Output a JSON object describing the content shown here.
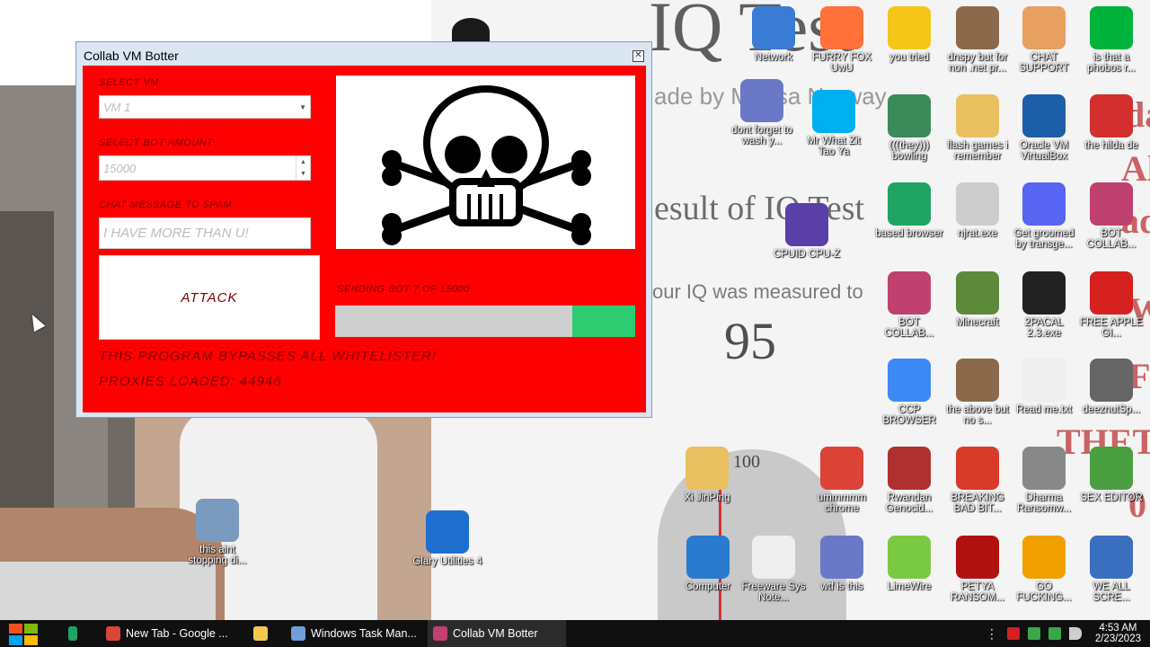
{
  "window": {
    "title": "Collab VM Botter",
    "close_glyph": "✕",
    "select_vm_label": "SELECT VM",
    "select_vm_value": "VM 1",
    "bot_amount_label": "SELECT BOT AMOUNT",
    "bot_amount_value": "15000",
    "chat_label": "CHAT MESSAGE TO SPAM",
    "chat_placeholder": "I HAVE MORE THAN U!",
    "attack_button": "ATTACK",
    "progress_label": "SENDING BOT 7 OF 15000",
    "progress_fraction": 0.21,
    "bypass_text": "THIS PROGRAM BYPASSES ALL WHITELISTER!",
    "proxies_text": "PROXIES LOADED: 44946",
    "colors": {
      "client": "#ff0000",
      "progress_fill": "#2ecc71"
    }
  },
  "wallpaper": {
    "iq_title": "IQ Test",
    "iq_by": "ade by Mensa Norway",
    "iq_result": "esult of IQ Test",
    "iq_measured": "our IQ was measured to",
    "iq_score": "95",
    "bell_label": "100",
    "side_texts": [
      "da",
      "Alt",
      "ade",
      "W",
      "F",
      "THETA",
      "0"
    ]
  },
  "desktop_icons": [
    {
      "label": "Network",
      "icon": "network-icon",
      "color": "#3a7bd5"
    },
    {
      "label": "FURRY FOX UwU",
      "icon": "firefox-icon",
      "color": "#ff7139"
    },
    {
      "label": "you tried",
      "icon": "star-icon",
      "color": "#f5c518"
    },
    {
      "label": "dnspy but for non .net pr...",
      "icon": "portrait-icon",
      "color": "#8a6a4a"
    },
    {
      "label": "CHAT SUPPORT",
      "icon": "support-icon",
      "color": "#e8a060"
    },
    {
      "label": "is that a phobos r...",
      "icon": "icq-icon",
      "color": "#00b33c"
    },
    {
      "label": "dont forget to wash y...",
      "icon": "calendar-icon",
      "color": "#6b78c8"
    },
    {
      "label": "Mr What Zit Tao Ya",
      "icon": "skype-icon",
      "color": "#00aff0"
    },
    {
      "label": "(((they))) bowling",
      "icon": "elf-icon",
      "color": "#3a8a5a"
    },
    {
      "label": "flash games i remember",
      "icon": "folder-icon",
      "color": "#e8c060"
    },
    {
      "label": "Oracle VM VirtualBox",
      "icon": "virtualbox-icon",
      "color": "#1c5fa8"
    },
    {
      "label": "the hilda de",
      "icon": "devcpp-icon",
      "color": "#d32f2f"
    },
    {
      "label": "CPUID CPU-Z",
      "icon": "cpuz-icon",
      "color": "#5b3fa8"
    },
    {
      "label": "based browser",
      "icon": "browser-icon",
      "color": "#1fa463"
    },
    {
      "label": "njrat.exe",
      "icon": "skull-icon",
      "color": "#cccccc"
    },
    {
      "label": "Get groomed by transge...",
      "icon": "discord-icon",
      "color": "#5865f2"
    },
    {
      "label": "BOT COLLAB...",
      "icon": "monitor-icon",
      "color": "#c04070"
    },
    {
      "label": "BOT COLLAB...",
      "icon": "monitor-icon",
      "color": "#c04070"
    },
    {
      "label": "Minecraft",
      "icon": "minecraft-icon",
      "color": "#5d8a3a"
    },
    {
      "label": "2PACAL 2.3.exe",
      "icon": "console-icon",
      "color": "#222222"
    },
    {
      "label": "FREE APPLE GI...",
      "icon": "apple-icon",
      "color": "#d61f1f"
    },
    {
      "label": "CCP BROWSER",
      "icon": "chromium-icon",
      "color": "#3d8af7"
    },
    {
      "label": "the above but no s...",
      "icon": "portrait-icon",
      "color": "#8a6a4a"
    },
    {
      "label": "Read me.txt",
      "icon": "document-icon",
      "color": "#eeeeee"
    },
    {
      "label": "deeznutSp...",
      "icon": "windows-stack-icon",
      "color": "#666666"
    },
    {
      "label": "Xi JinPing",
      "icon": "folder-icon",
      "color": "#e8c060"
    },
    {
      "label": "ummmmm chrome",
      "icon": "chrome-icon",
      "color": "#db4437"
    },
    {
      "label": "Rwandan Genocid...",
      "icon": "meme-icon",
      "color": "#b03030"
    },
    {
      "label": "BREAKING BAD BIT...",
      "icon": "angrybirds-icon",
      "color": "#d83a2a"
    },
    {
      "label": "Dharma Ransomw...",
      "icon": "skull-icon",
      "color": "#888888"
    },
    {
      "label": "SEX EDITOR",
      "icon": "hxd-icon",
      "color": "#4aa040"
    },
    {
      "label": "this aint stopping di...",
      "icon": "scanner-icon",
      "color": "#7a9abf"
    },
    {
      "label": "Glary Utilities 4",
      "icon": "glary-icon",
      "color": "#1e6fd0"
    },
    {
      "label": "Computer",
      "icon": "computer-icon",
      "color": "#2a7ad0"
    },
    {
      "label": "Freeware Sys Note...",
      "icon": "document-icon",
      "color": "#eeeeee"
    },
    {
      "label": "wtf is this",
      "icon": "calendar-icon",
      "color": "#6b78c8"
    },
    {
      "label": "LimeWire",
      "icon": "limewire-icon",
      "color": "#7ac943"
    },
    {
      "label": "PETYA RANSOM...",
      "icon": "petya-icon",
      "color": "#b01010"
    },
    {
      "label": "GO FUCKING...",
      "icon": "de-icon",
      "color": "#f0a000"
    },
    {
      "label": "WE ALL SCRE...",
      "icon": "computer-icon",
      "color": "#3a6fc0"
    }
  ],
  "taskbar": {
    "items": [
      {
        "label": "",
        "icon": "greenshot-icon",
        "color": "#1fa463"
      },
      {
        "label": "New Tab - Google ...",
        "icon": "chrome-icon",
        "color": "#db4437"
      },
      {
        "label": "",
        "icon": "file-explorer-icon",
        "color": "#f2c94c"
      },
      {
        "label": "Windows Task Man...",
        "icon": "task-manager-icon",
        "color": "#6f9fd8"
      },
      {
        "label": "Collab VM Botter",
        "icon": "app-icon",
        "color": "#c04070"
      }
    ],
    "time": "4:53 AM",
    "date": "2/23/2023"
  }
}
